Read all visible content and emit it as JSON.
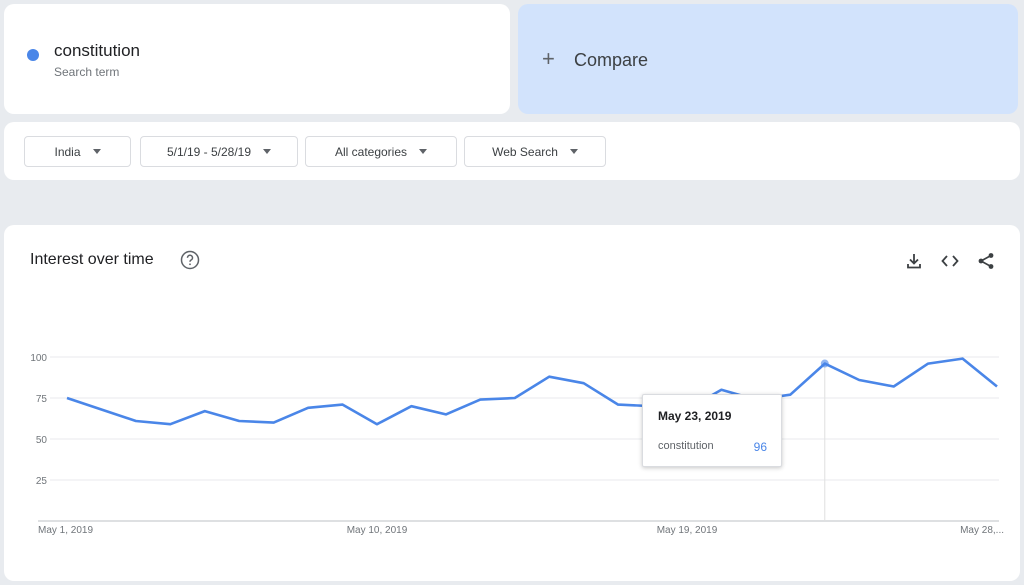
{
  "colors": {
    "series": "#4a86e8",
    "compare_bg": "#d2e3fc"
  },
  "search_term": {
    "name": "constitution",
    "subtitle": "Search term"
  },
  "compare": {
    "label": "Compare",
    "icon": "plus-icon"
  },
  "filters": {
    "region": "India",
    "date_range": "5/1/19 - 5/28/19",
    "category": "All categories",
    "search_type": "Web Search"
  },
  "chart": {
    "title": "Interest over time",
    "icons": [
      "help-icon",
      "download-icon",
      "embed-icon",
      "share-icon"
    ]
  },
  "tooltip": {
    "date": "May 23, 2019",
    "term": "constitution",
    "value": "96"
  },
  "chart_data": {
    "type": "line",
    "title": "Interest over time",
    "xlabel": "",
    "ylabel": "",
    "x": [
      "May 1, 2019",
      "May 2, 2019",
      "May 3, 2019",
      "May 4, 2019",
      "May 5, 2019",
      "May 6, 2019",
      "May 7, 2019",
      "May 8, 2019",
      "May 9, 2019",
      "May 10, 2019",
      "May 11, 2019",
      "May 12, 2019",
      "May 13, 2019",
      "May 14, 2019",
      "May 15, 2019",
      "May 16, 2019",
      "May 17, 2019",
      "May 18, 2019",
      "May 19, 2019",
      "May 20, 2019",
      "May 21, 2019",
      "May 22, 2019",
      "May 23, 2019",
      "May 24, 2019",
      "May 25, 2019",
      "May 26, 2019",
      "May 27, 2019",
      "May 28, 2019"
    ],
    "x_tick_labels": [
      "May 1, 2019",
      "May 10, 2019",
      "May 19, 2019",
      "May 28,..."
    ],
    "x_tick_index": [
      0,
      9,
      18,
      27
    ],
    "y_ticks": [
      25,
      50,
      75,
      100
    ],
    "ylim": [
      0,
      100
    ],
    "grid": true,
    "series": [
      {
        "name": "constitution",
        "values": [
          75,
          68,
          61,
          59,
          67,
          61,
          60,
          69,
          71,
          59,
          70,
          65,
          74,
          75,
          88,
          84,
          71,
          70,
          68,
          80,
          74,
          77,
          96,
          86,
          82,
          96,
          99,
          82
        ]
      }
    ],
    "highlight_index": 22
  }
}
